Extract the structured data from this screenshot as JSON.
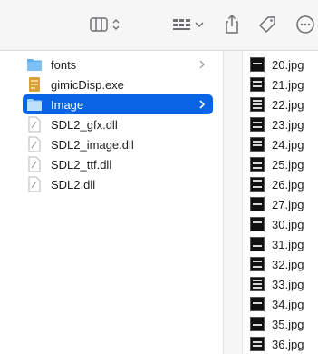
{
  "toolbar": {
    "view_icon": "columns-view-icon",
    "group_icon": "group-by-icon",
    "share_icon": "share-icon",
    "tag_icon": "tag-icon",
    "more_icon": "more-icon"
  },
  "column1": {
    "items": [
      {
        "name": "fonts",
        "kind": "folder"
      },
      {
        "name": "gimicDisp.exe",
        "kind": "exe"
      },
      {
        "name": "Image",
        "kind": "folder",
        "selected": true
      },
      {
        "name": "SDL2_gfx.dll",
        "kind": "doc"
      },
      {
        "name": "SDL2_image.dll",
        "kind": "doc"
      },
      {
        "name": "SDL2_ttf.dll",
        "kind": "doc"
      },
      {
        "name": "SDL2.dll",
        "kind": "doc"
      }
    ]
  },
  "column2": {
    "files": [
      "20.jpg",
      "21.jpg",
      "22.jpg",
      "23.jpg",
      "24.jpg",
      "25.jpg",
      "26.jpg",
      "27.jpg",
      "30.jpg",
      "31.jpg",
      "32.jpg",
      "33.jpg",
      "34.jpg",
      "35.jpg",
      "36.jpg"
    ]
  },
  "colors": {
    "selection": "#0a64e6",
    "folder": "#5fb0f0"
  }
}
